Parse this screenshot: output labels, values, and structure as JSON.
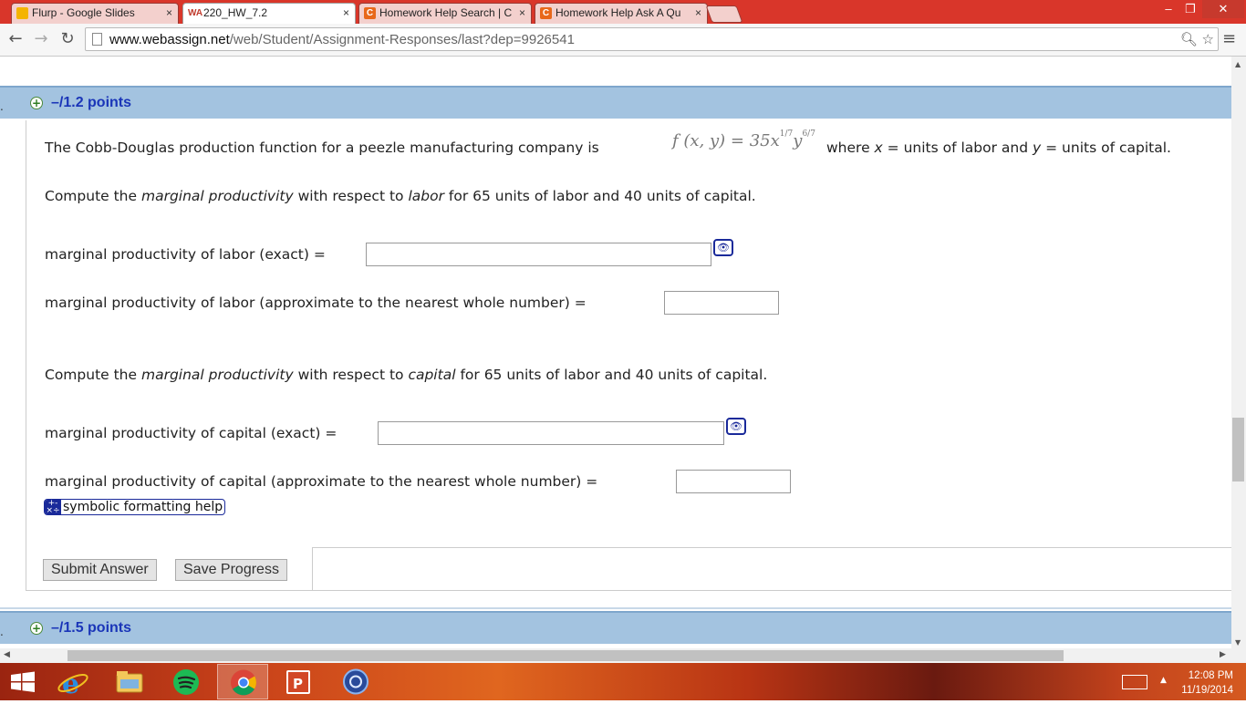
{
  "browser": {
    "tabs": [
      {
        "title": "Flurp - Google Slides",
        "favicon": "slides-icon",
        "favicon_text": "",
        "color": "#f4b400"
      },
      {
        "title": "220_HW_7.2",
        "favicon": "webassign-icon",
        "favicon_text": "WA",
        "color": "#c0392b"
      },
      {
        "title": "Homework Help Search | C",
        "favicon": "chegg-icon",
        "favicon_text": "C",
        "color": "#e8681a"
      },
      {
        "title": "Homework Help Ask A Qu",
        "favicon": "chegg-icon",
        "favicon_text": "C",
        "color": "#e8681a"
      }
    ],
    "close_glyph": "×",
    "url_host": "www.webassign.net",
    "url_path": "/web/Student/Assignment-Responses/last?dep=9926541"
  },
  "question1": {
    "points": "–/1.2 points",
    "intro_pre": "The Cobb-Douglas production function for a peezle manufacturing company is",
    "formula": "f (x, y) = 35x",
    "formula_exp_x": "1/7",
    "formula_y": "y",
    "formula_exp_y": "6/7",
    "intro_post_1": "where",
    "var_x": "x",
    "intro_post_2": "= units of labor and",
    "var_y": "y",
    "intro_post_3": "= units of capital.",
    "labor_prompt_a": "Compute the",
    "labor_prompt_em1": "marginal productivity",
    "labor_prompt_b": "with respect to",
    "labor_prompt_em2": "labor",
    "labor_prompt_c": "for 65 units of labor and 40 units of capital.",
    "labor_exact_label": "marginal productivity of labor (exact) =",
    "labor_exact_value": "",
    "labor_approx_label": "marginal productivity of labor (approximate to the nearest whole number) =",
    "labor_approx_value": "",
    "capital_prompt_a": "Compute the",
    "capital_prompt_em1": "marginal productivity",
    "capital_prompt_b": "with respect to",
    "capital_prompt_em2": "capital",
    "capital_prompt_c": "for 65 units of labor and 40 units of capital.",
    "capital_exact_label": "marginal productivity of capital (exact) =",
    "capital_exact_value": "",
    "capital_approx_label": "marginal productivity of capital (approximate to the nearest whole number) =",
    "capital_approx_value": "",
    "symbolic_help": "symbolic formatting help",
    "submit_label": "Submit Answer",
    "save_label": "Save Progress"
  },
  "question2": {
    "points": "–/1.5 points"
  },
  "taskbar": {
    "apps": [
      "windows-start",
      "internet-explorer",
      "file-explorer",
      "spotify",
      "chrome",
      "powerpoint",
      "media-app"
    ],
    "time": "12:08 PM",
    "date": "11/19/2014"
  }
}
